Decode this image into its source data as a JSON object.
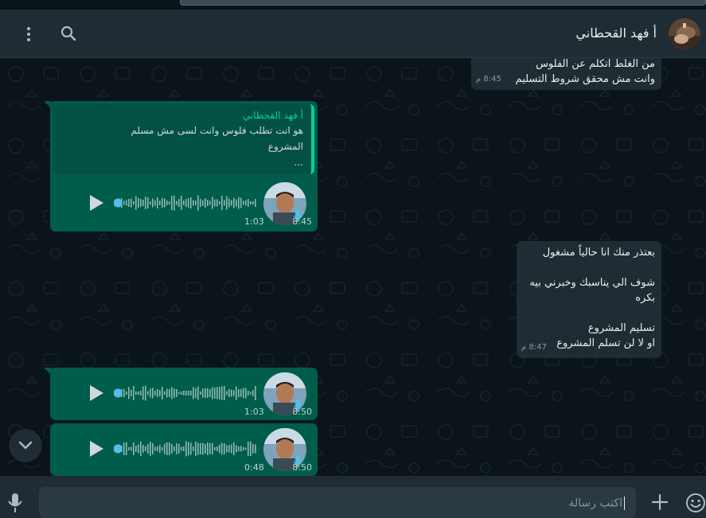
{
  "header": {
    "contact_name": "أ فهد القحطاني"
  },
  "messages": {
    "m1": {
      "line1": "من الغلط اتكلم عن الفلوس",
      "line2": "وانت مش محقق شروط التسليم",
      "time": "8:45 م"
    },
    "m2": {
      "quote_name": "أ فهد القحطاني",
      "quote_line1": "هو انت تطلب فلوس وانت لسى مش مسلم",
      "quote_line2": "المشروع",
      "quote_line3": "...",
      "duration": "1:03",
      "time": "8:45"
    },
    "m3": {
      "line1": "بعتذر منك انا حالياً مشغول",
      "line2": "شوف الي يناسبك وخبرني بيه",
      "line3": "بكره",
      "line4": "تسليم المشروع",
      "line5": "او لا لن تسلم المشروع",
      "time": "8:47 م"
    },
    "m4": {
      "duration": "1:03",
      "time": "8:50"
    },
    "m5": {
      "duration": "0:48",
      "time": "8:50"
    }
  },
  "composer": {
    "placeholder": "اكتب رسالة"
  },
  "colors": {
    "incoming_bubble": "#005c4b",
    "outgoing_bubble": "#202c33",
    "accent": "#06cf9c",
    "header": "#202c33"
  },
  "icons": {
    "menu": "vertical-dots-icon",
    "search": "search-icon",
    "play": "play-icon",
    "scroll_down": "chevron-down-icon",
    "mic": "mic-icon",
    "attach": "plus-icon",
    "emoji": "emoji-icon"
  }
}
